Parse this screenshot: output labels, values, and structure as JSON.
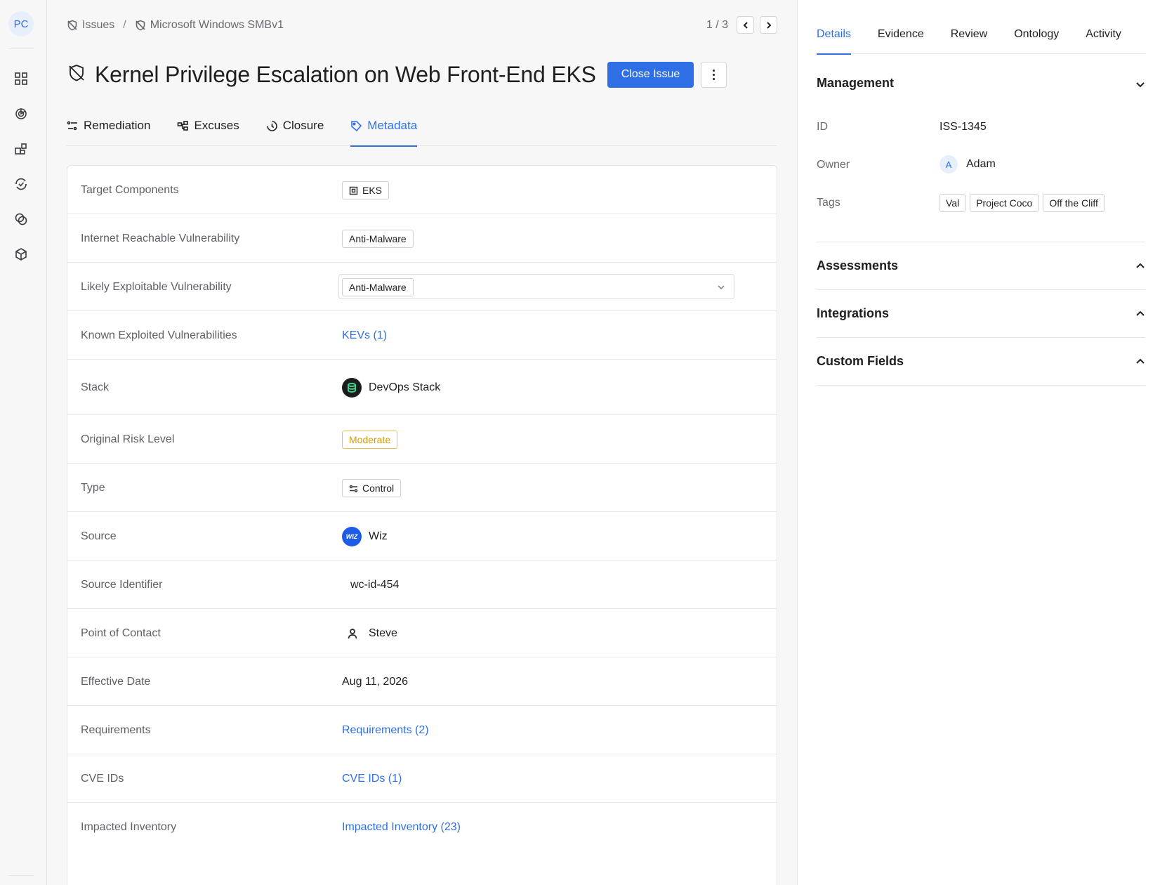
{
  "rail": {
    "avatar_initials": "PC",
    "icons": [
      "dashboard-icon",
      "chart-icon",
      "widgets-icon",
      "sync-check-icon",
      "links-icon",
      "package-icon"
    ]
  },
  "breadcrumb": {
    "items": [
      "Issues",
      "Microsoft Windows SMBv1"
    ],
    "separator": "/"
  },
  "pager": {
    "text": "1 / 3"
  },
  "issue": {
    "title": "Kernel Privilege Escalation on Web Front-End EKS",
    "close_label": "Close Issue"
  },
  "tabs": [
    {
      "label": "Remediation",
      "icon": "remediation-icon",
      "active": false
    },
    {
      "label": "Excuses",
      "icon": "excuses-icon",
      "active": false
    },
    {
      "label": "Closure",
      "icon": "closure-icon",
      "active": false
    },
    {
      "label": "Metadata",
      "icon": "metadata-icon",
      "active": true
    }
  ],
  "metadata": {
    "target_components": {
      "label": "Target Components",
      "value": "EKS"
    },
    "internet_reachable": {
      "label": "Internet Reachable Vulnerability",
      "value": "Anti-Malware"
    },
    "likely_exploitable": {
      "label": "Likely Exploitable Vulnerability",
      "value": "Anti-Malware"
    },
    "kev": {
      "label": "Known Exploited Vulnerabilities",
      "value": "KEVs (1)"
    },
    "stack": {
      "label": "Stack",
      "value": "DevOps Stack"
    },
    "risk": {
      "label": "Original Risk Level",
      "value": "Moderate"
    },
    "type": {
      "label": "Type",
      "value": "Control"
    },
    "source": {
      "label": "Source",
      "value": "Wiz",
      "logo_text": "WIZ"
    },
    "source_id": {
      "label": "Source Identifier",
      "value": "wc-id-454"
    },
    "contact": {
      "label": "Point of Contact",
      "value": "Steve"
    },
    "effective_date": {
      "label": "Effective Date",
      "value": "Aug 11, 2026"
    },
    "requirements": {
      "label": "Requirements",
      "value": "Requirements (2)"
    },
    "cve_ids": {
      "label": "CVE IDs",
      "value": "CVE IDs (1)"
    },
    "impacted_inventory": {
      "label": "Impacted Inventory",
      "value": "Impacted Inventory (23)"
    }
  },
  "right_tabs": [
    "Details",
    "Evidence",
    "Review",
    "Ontology",
    "Activity"
  ],
  "management": {
    "title": "Management",
    "id_label": "ID",
    "id_value": "ISS-1345",
    "owner_label": "Owner",
    "owner_initial": "A",
    "owner_value": "Adam",
    "tags_label": "Tags",
    "tags": [
      "Val",
      "Project Coco",
      "Off the Cliff"
    ]
  },
  "sections": [
    "Assessments",
    "Integrations",
    "Custom Fields"
  ],
  "colors": {
    "accent": "#2f6fe6",
    "moderate": "#d29d0f",
    "wiz": "#1e5ce8",
    "stack_green": "#3fce8f"
  }
}
